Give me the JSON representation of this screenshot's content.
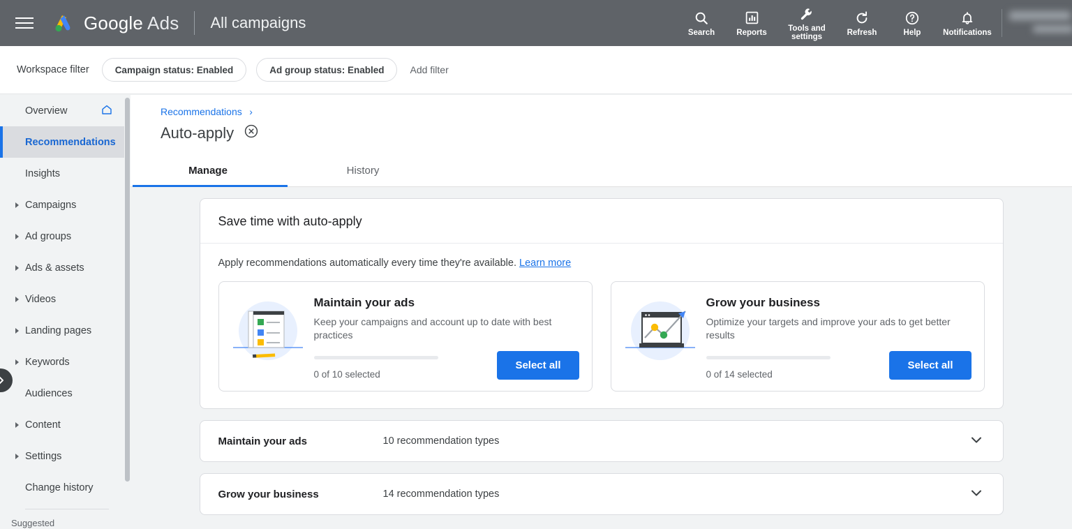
{
  "topbar": {
    "brand_google": "Google",
    "brand_ads": "Ads",
    "context_title": "All campaigns",
    "actions": [
      {
        "label": "Search",
        "icon": "search-icon"
      },
      {
        "label": "Reports",
        "icon": "reports-icon"
      },
      {
        "label": "Tools and settings",
        "icon": "tools-icon"
      },
      {
        "label": "Refresh",
        "icon": "refresh-icon"
      },
      {
        "label": "Help",
        "icon": "help-icon"
      },
      {
        "label": "Notifications",
        "icon": "bell-icon"
      }
    ]
  },
  "filterbar": {
    "label": "Workspace filter",
    "chips": [
      "Campaign status: Enabled",
      "Ad group status: Enabled"
    ],
    "add_filter": "Add filter"
  },
  "sidebar": {
    "items": [
      {
        "label": "Overview",
        "expandable": false,
        "active": false,
        "trailing_icon": "home-icon"
      },
      {
        "label": "Recommendations",
        "expandable": false,
        "active": true
      },
      {
        "label": "Insights",
        "expandable": false,
        "active": false
      },
      {
        "label": "Campaigns",
        "expandable": true,
        "active": false
      },
      {
        "label": "Ad groups",
        "expandable": true,
        "active": false
      },
      {
        "label": "Ads & assets",
        "expandable": true,
        "active": false
      },
      {
        "label": "Videos",
        "expandable": true,
        "active": false
      },
      {
        "label": "Landing pages",
        "expandable": true,
        "active": false
      },
      {
        "label": "Keywords",
        "expandable": true,
        "active": false
      },
      {
        "label": "Audiences",
        "expandable": false,
        "active": false
      },
      {
        "label": "Content",
        "expandable": true,
        "active": false
      },
      {
        "label": "Settings",
        "expandable": true,
        "active": false
      },
      {
        "label": "Change history",
        "expandable": false,
        "active": false
      }
    ],
    "section_label": "Suggested"
  },
  "main": {
    "breadcrumb": "Recommendations",
    "page_title": "Auto-apply",
    "tabs": [
      {
        "label": "Manage",
        "active": true
      },
      {
        "label": "History",
        "active": false
      }
    ],
    "card": {
      "title": "Save time with auto-apply",
      "description": "Apply recommendations automatically every time they're available.",
      "learn_more": "Learn more",
      "tiles": [
        {
          "title": "Maintain your ads",
          "description": "Keep your campaigns and account up to date with best practices",
          "selected_count": "0 of 10 selected",
          "button_label": "Select all",
          "illustration": "checklist-illustration",
          "progress_percent": 0
        },
        {
          "title": "Grow your business",
          "description": "Optimize your targets and improve your ads to get better results",
          "selected_count": "0 of 14 selected",
          "button_label": "Select all",
          "illustration": "growth-chart-illustration",
          "progress_percent": 0
        }
      ]
    },
    "accordions": [
      {
        "name": "Maintain your ads",
        "meta": "10 recommendation types"
      },
      {
        "name": "Grow your business",
        "meta": "14 recommendation types"
      }
    ]
  },
  "colors": {
    "accent_blue": "#1a73e8",
    "topbar_gray": "#5f6368",
    "page_bg": "#f1f3f4"
  }
}
